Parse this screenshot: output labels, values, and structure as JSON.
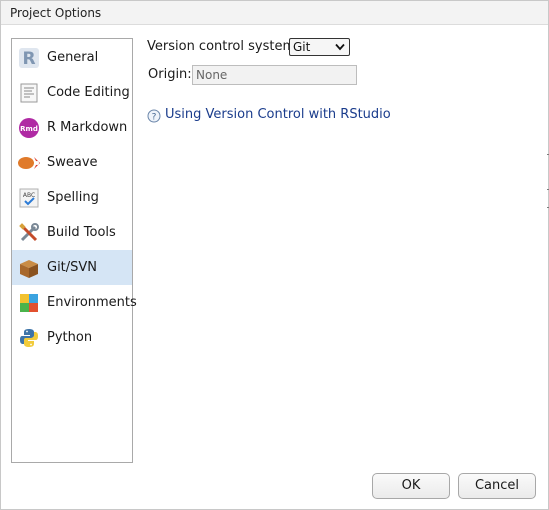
{
  "window": {
    "title": "Project Options"
  },
  "sidebar": {
    "items": [
      {
        "label": "General",
        "icon": "r-logo-icon",
        "selected": false
      },
      {
        "label": "Code Editing",
        "icon": "code-editing-icon",
        "selected": false
      },
      {
        "label": "R Markdown",
        "icon": "rmarkdown-icon",
        "selected": false
      },
      {
        "label": "Sweave",
        "icon": "sweave-icon",
        "selected": false
      },
      {
        "label": "Spelling",
        "icon": "spelling-icon",
        "selected": false
      },
      {
        "label": "Build Tools",
        "icon": "build-tools-icon",
        "selected": false
      },
      {
        "label": "Git/SVN",
        "icon": "git-svn-icon",
        "selected": true
      },
      {
        "label": "Environments",
        "icon": "environments-icon",
        "selected": false
      },
      {
        "label": "Python",
        "icon": "python-icon",
        "selected": false
      }
    ],
    "selected_color": "#d5e5f5"
  },
  "main": {
    "vcs_label": "Version control system:",
    "vcs_value": "Git",
    "origin_label": "Origin:",
    "origin_value": "None",
    "help_link": "Using Version Control with RStudio",
    "link_color": "#1a3c8c"
  },
  "buttons": {
    "ok": "OK",
    "cancel": "Cancel"
  }
}
